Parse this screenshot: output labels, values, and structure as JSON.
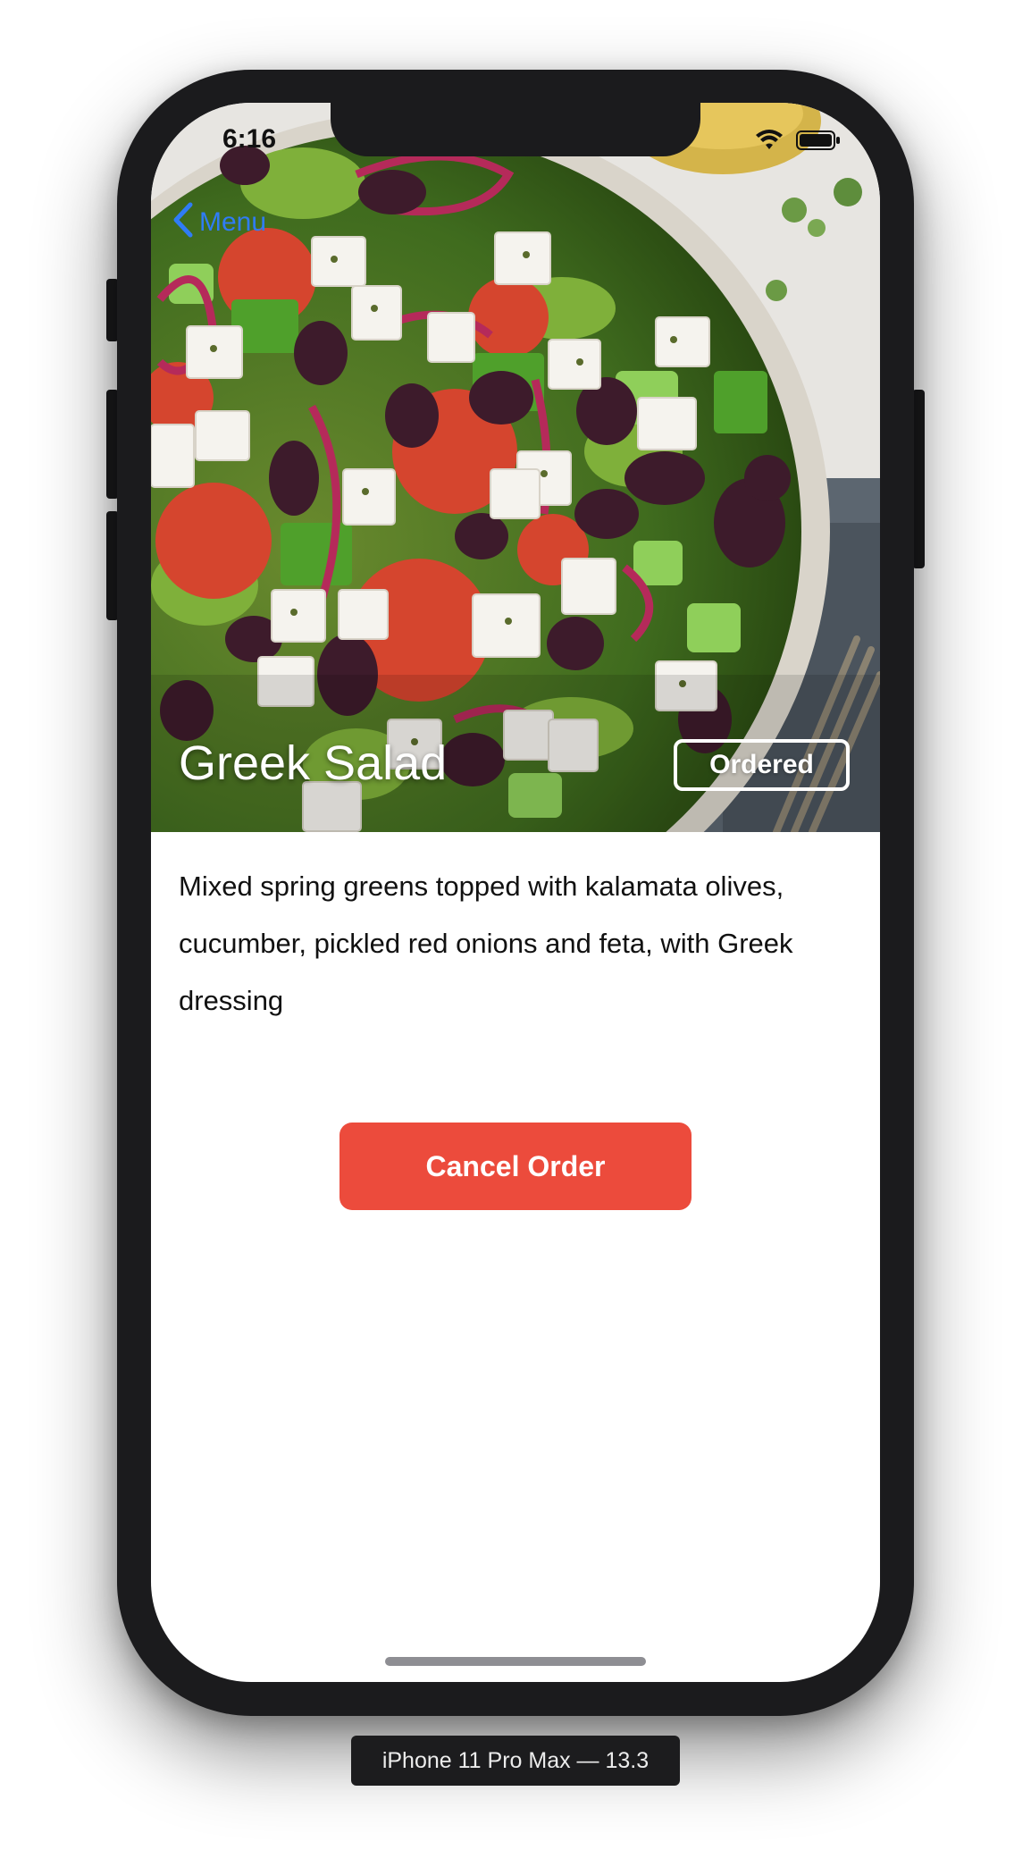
{
  "status_bar": {
    "time": "6:16",
    "wifi_icon": "wifi-icon",
    "battery_icon": "battery-icon"
  },
  "nav": {
    "back_label": "Menu",
    "back_icon": "chevron-left-icon",
    "accent_color": "#2f7cf6"
  },
  "dish": {
    "name": "Greek Salad",
    "status": "Ordered",
    "description": "Mixed spring greens topped with kalamata olives, cucumber, pickled red onions and feta, with Greek dressing",
    "image": "greek-salad-photo"
  },
  "actions": {
    "cancel_label": "Cancel Order",
    "cancel_color": "#ec4b3c"
  },
  "device": {
    "label": "iPhone 11 Pro Max — 13.3"
  }
}
